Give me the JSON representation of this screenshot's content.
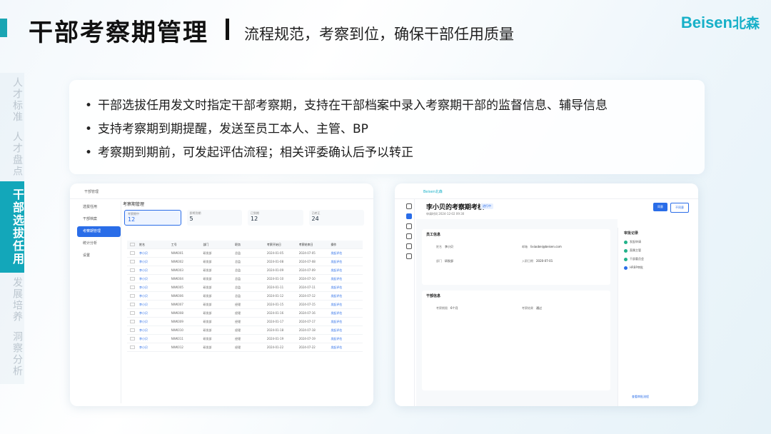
{
  "header": {
    "title": "干部考察期管理",
    "subtitle": "流程规范，考察到位，确保干部任用质量",
    "logo_en": "Beisen",
    "logo_cn": "北森",
    "accent_color": "#13a7ba"
  },
  "side_tabs": [
    {
      "label": "人才标准",
      "active": false
    },
    {
      "label": "人才盘点",
      "active": false
    },
    {
      "label": "干部选拔任用",
      "active": true
    },
    {
      "label": "发展培养",
      "active": false
    },
    {
      "label": "洞察分析",
      "active": false
    }
  ],
  "bullets": [
    "干部选拔任用发文时指定干部考察期，支持在干部档案中录入考察期干部的监督信息、辅导信息",
    "支持考察期到期提醒，发送至员工本人、主管、BP",
    "考察期到期前，可发起评估流程；相关评委确认后予以转正"
  ],
  "screenshot1": {
    "top_title": "干部管理",
    "page_title": "考察期管理",
    "sidebar": [
      "选拔任用",
      "干部档案",
      "考察期管理",
      "统计分析",
      "设置"
    ],
    "stats": [
      {
        "label": "考察期中",
        "value": "12"
      },
      {
        "label": "即将到期",
        "value": "5"
      },
      {
        "label": "已到期",
        "value": "12"
      },
      {
        "label": "已转正",
        "value": "24"
      }
    ],
    "columns": [
      "姓名",
      "工号",
      "部门",
      "职务",
      "考察开始日",
      "考察结束日",
      "操作"
    ],
    "rows": [
      [
        "李小贝",
        "NWK001",
        "研发部",
        "总监",
        "2024-01-05",
        "2024-07-05",
        "发起评估"
      ],
      [
        "李小贝",
        "NWK002",
        "研发部",
        "总监",
        "2024-01-08",
        "2024-07-08",
        "发起评估"
      ],
      [
        "李小贝",
        "NWK003",
        "研发部",
        "总监",
        "2024-01-09",
        "2024-07-09",
        "发起评估"
      ],
      [
        "李小贝",
        "NWK004",
        "研发部",
        "总监",
        "2024-01-10",
        "2024-07-10",
        "发起评估"
      ],
      [
        "李小贝",
        "NWK005",
        "研发部",
        "总监",
        "2024-01-11",
        "2024-07-11",
        "发起评估"
      ],
      [
        "李小贝",
        "NWK006",
        "研发部",
        "总监",
        "2024-01-12",
        "2024-07-12",
        "发起评估"
      ],
      [
        "李小贝",
        "NWK007",
        "研发部",
        "经理",
        "2024-01-15",
        "2024-07-15",
        "发起评估"
      ],
      [
        "李小贝",
        "NWK008",
        "研发部",
        "经理",
        "2024-01-16",
        "2024-07-16",
        "发起评估"
      ],
      [
        "李小贝",
        "NWK009",
        "研发部",
        "经理",
        "2024-01-17",
        "2024-07-17",
        "发起评估"
      ],
      [
        "李小贝",
        "NWK010",
        "研发部",
        "经理",
        "2024-01-18",
        "2024-07-18",
        "发起评估"
      ],
      [
        "李小贝",
        "NWK011",
        "研发部",
        "经理",
        "2024-01-19",
        "2024-07-19",
        "发起评估"
      ],
      [
        "李小贝",
        "NWK012",
        "研发部",
        "经理",
        "2024-01-22",
        "2024-07-22",
        "发起评估"
      ]
    ]
  },
  "screenshot2": {
    "brand": "Beisen北森",
    "title": "李小贝的考察期考核",
    "badge": "进行中",
    "meta": "申请时间 2024-12-02 09:30",
    "btn_primary": "同意",
    "btn_secondary": "不同意",
    "section1": "员工信息",
    "section2": "干部信息",
    "fields1": [
      [
        "姓名",
        "李小贝"
      ],
      [
        "邮箱",
        "lixiaobei@beisen.com"
      ],
      [
        "部门",
        "研发部"
      ],
      [
        "入职日期",
        "2020-07-01"
      ]
    ],
    "fields2": [
      [
        "考察期限",
        "6个月"
      ],
      [
        "考察结果",
        "通过"
      ]
    ],
    "right_title": "审批记录",
    "timeline": [
      "发起申请",
      "直属主管",
      "干部委员会",
      "HRBP审批"
    ],
    "foot": "查看审批流程"
  }
}
